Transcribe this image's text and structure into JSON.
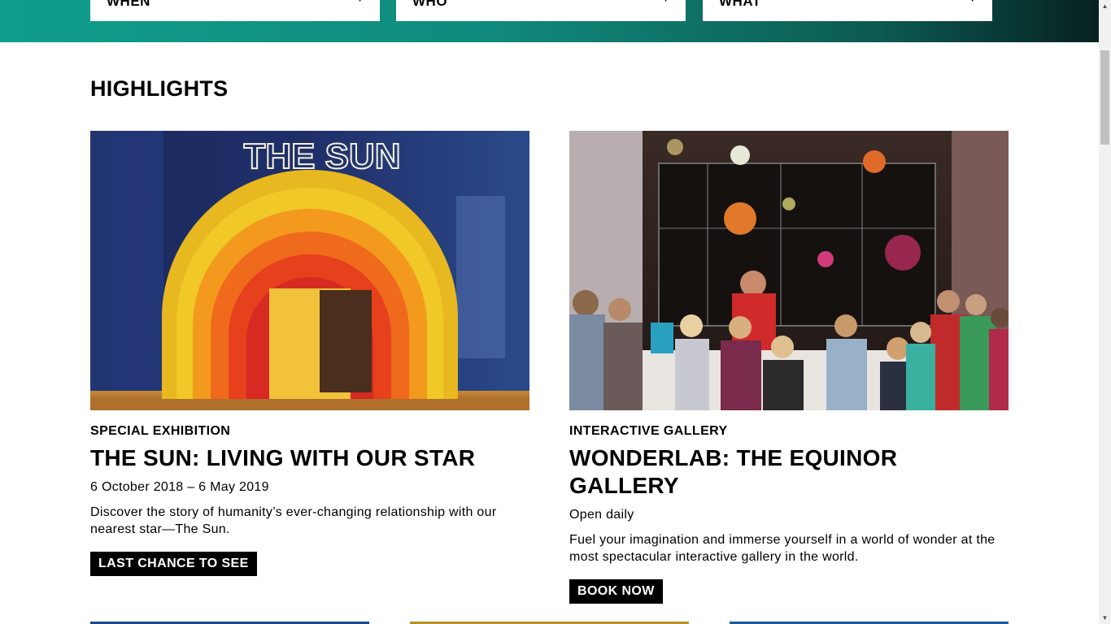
{
  "filters": [
    {
      "label": "WHEN"
    },
    {
      "label": "WHO"
    },
    {
      "label": "WHAT"
    }
  ],
  "highlights": {
    "title": "HIGHLIGHTS",
    "cards": [
      {
        "category": "SPECIAL EXHIBITION",
        "title": "THE SUN: LIVING WITH OUR STAR",
        "date": "6 October 2018 – 6 May 2019",
        "description": "Discover the story of humanity’s ever-changing relationship with our nearest star—The Sun.",
        "cta": "LAST CHANCE TO SEE",
        "image_sign": "THE SUN"
      },
      {
        "category": "INTERACTIVE GALLERY",
        "title": "WONDERLAB: THE EQUINOR GALLERY",
        "date": "Open daily",
        "description": "Fuel your imagination and immerse yourself in a world of wonder at the most spectacular interactive gallery in the world.",
        "cta": "BOOK NOW"
      }
    ]
  },
  "icons": {
    "caret": "caret-down-icon",
    "scroll_up": "scroll-up-arrow-icon",
    "scroll_down": "scroll-down-arrow-icon"
  },
  "colors": {
    "band_start": "#0f9e8c",
    "band_end": "#06211f",
    "cta_bg": "#000000",
    "cta_text": "#ffffff"
  }
}
